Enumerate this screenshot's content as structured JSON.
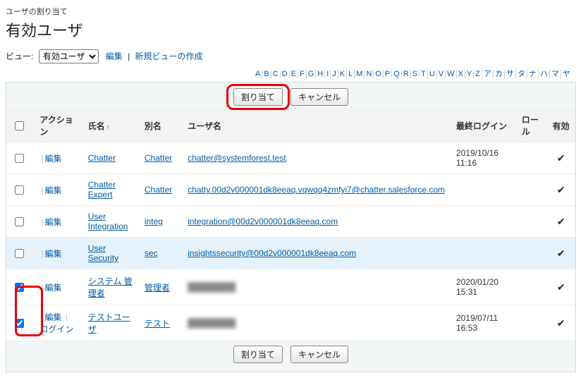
{
  "breadcrumb": "ユーザの割り当て",
  "page_title": "有効ユーザ",
  "view": {
    "label": "ビュー:",
    "selected": "有効ユーザ",
    "edit_link": "編集",
    "new_link": "新規ビューの作成"
  },
  "alpha": [
    "A",
    "B",
    "C",
    "D",
    "E",
    "F",
    "G",
    "H",
    "I",
    "J",
    "K",
    "L",
    "M",
    "N",
    "O",
    "P",
    "Q",
    "R",
    "S",
    "T",
    "U",
    "V",
    "W",
    "X",
    "Y",
    "Z",
    "ア",
    "カ",
    "サ",
    "タ",
    "ナ",
    "ハ",
    "マ",
    "ヤ"
  ],
  "buttons": {
    "assign": "割り当て",
    "cancel": "キャンセル"
  },
  "columns": {
    "action": "アクション",
    "name": "氏名",
    "alias": "別名",
    "username": "ユーザ名",
    "last_login": "最終ログイン",
    "role": "ロール",
    "active": "有効"
  },
  "action_labels": {
    "edit": "編集",
    "login": "ログイン"
  },
  "rows": [
    {
      "checked": false,
      "name": "Chatter",
      "alias": "Chatter",
      "username": "chatter@systemforest.test",
      "last_login": "2019/10/16 11:16",
      "role": "",
      "active": true,
      "login_link": false
    },
    {
      "checked": false,
      "name": "Chatter Expert",
      "alias": "Chatter",
      "username": "chatty.00d2v000001dk8eeaq.vqwqq4zmfyi7@chatter.salesforce.com",
      "last_login": "",
      "role": "",
      "active": true,
      "login_link": false
    },
    {
      "checked": false,
      "name": "User Integration",
      "alias": "integ",
      "username": "integration@00d2v000001dk8eeaq.com",
      "last_login": "",
      "role": "",
      "active": true,
      "login_link": false
    },
    {
      "checked": false,
      "name": "User Security",
      "alias": "sec",
      "username": "insightssecurity@00d2v000001dk8eeaq.com",
      "last_login": "",
      "role": "",
      "active": true,
      "login_link": false,
      "hover": true
    },
    {
      "checked": true,
      "name": "システム 管理者",
      "alias": "管理者",
      "username": "████████",
      "last_login": "2020/01/20 15:31",
      "role": "",
      "active": true,
      "login_link": false,
      "blur_user": true
    },
    {
      "checked": true,
      "name": "テストユーザ",
      "alias": "テスト",
      "username": "████████",
      "last_login": "2019/07/11 16:53",
      "role": "",
      "active": true,
      "login_link": true,
      "blur_user": true
    }
  ]
}
